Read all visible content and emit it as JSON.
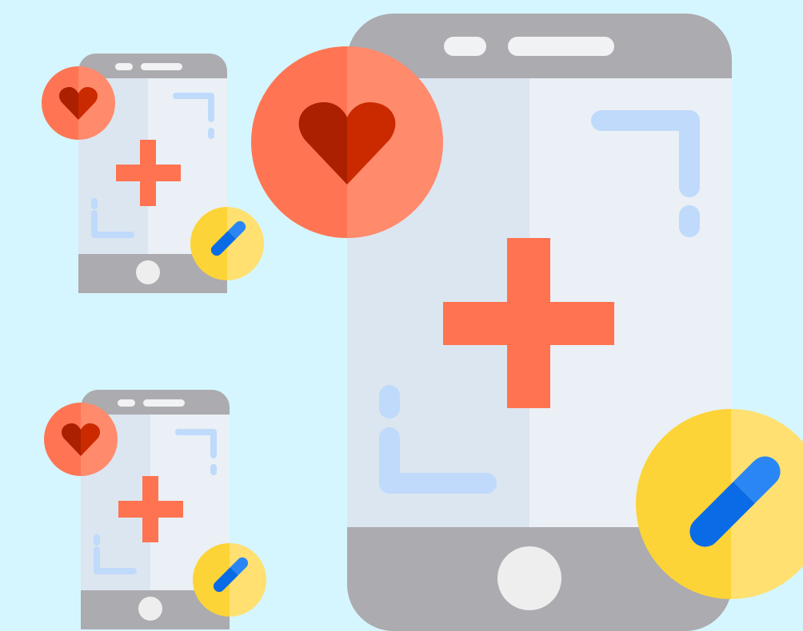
{
  "colors": {
    "background": "#D5F6FE",
    "phone_frame": "#ACABB0",
    "screen_left": "#DCE6F0",
    "screen_right": "#EAF0F5",
    "speaker_light": "#F1F2F3",
    "home_button": "#EEEEEF",
    "cross": "#FF7350",
    "viewfinder_bracket": "#BFDAFB",
    "heart_badge_dark": "#FF7553",
    "heart_badge_light": "#FF8A6C",
    "heart_dark": "#AA2000",
    "heart_light": "#CB2A00",
    "pill_badge_dark": "#FDD437",
    "pill_badge_light": "#FFE071",
    "pill_dark": "#0A6BE6",
    "pill_light": "#2A86F4"
  },
  "illustration": {
    "subject": "mobile-health-app",
    "icons": [
      "smartphone-icon",
      "heart-icon",
      "medical-cross-icon",
      "pill-icon"
    ]
  },
  "phones": [
    {
      "id": "phone-small-top",
      "icon": "smartphone-icon"
    },
    {
      "id": "phone-small-bottom",
      "icon": "smartphone-icon"
    },
    {
      "id": "phone-large",
      "icon": "smartphone-icon"
    }
  ]
}
